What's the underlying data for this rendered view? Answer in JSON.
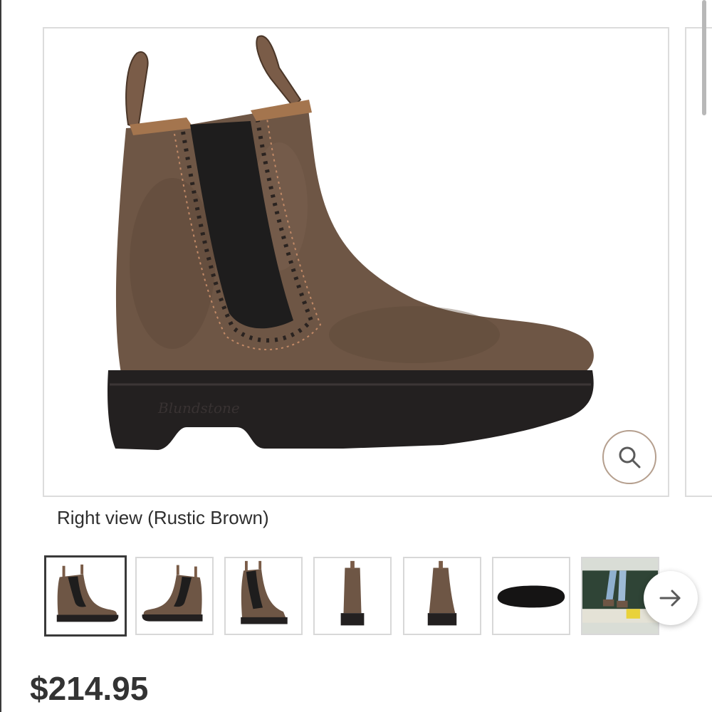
{
  "gallery": {
    "main_image_alt": "Right view (Rustic Brown)",
    "caption": "Right view (Rustic Brown)",
    "zoom_icon": "magnifier-icon",
    "next_icon": "arrow-right-icon",
    "thumbnails": [
      {
        "view": "right"
      },
      {
        "view": "left"
      },
      {
        "view": "three-quarter"
      },
      {
        "view": "back"
      },
      {
        "view": "front"
      },
      {
        "view": "sole"
      },
      {
        "view": "lifestyle"
      }
    ]
  },
  "product": {
    "price": "$214.95"
  },
  "colors": {
    "leather": "#6e5645",
    "sole": "#232020",
    "border": "#dcdcdc",
    "zoom_ring": "#b59f8e"
  }
}
